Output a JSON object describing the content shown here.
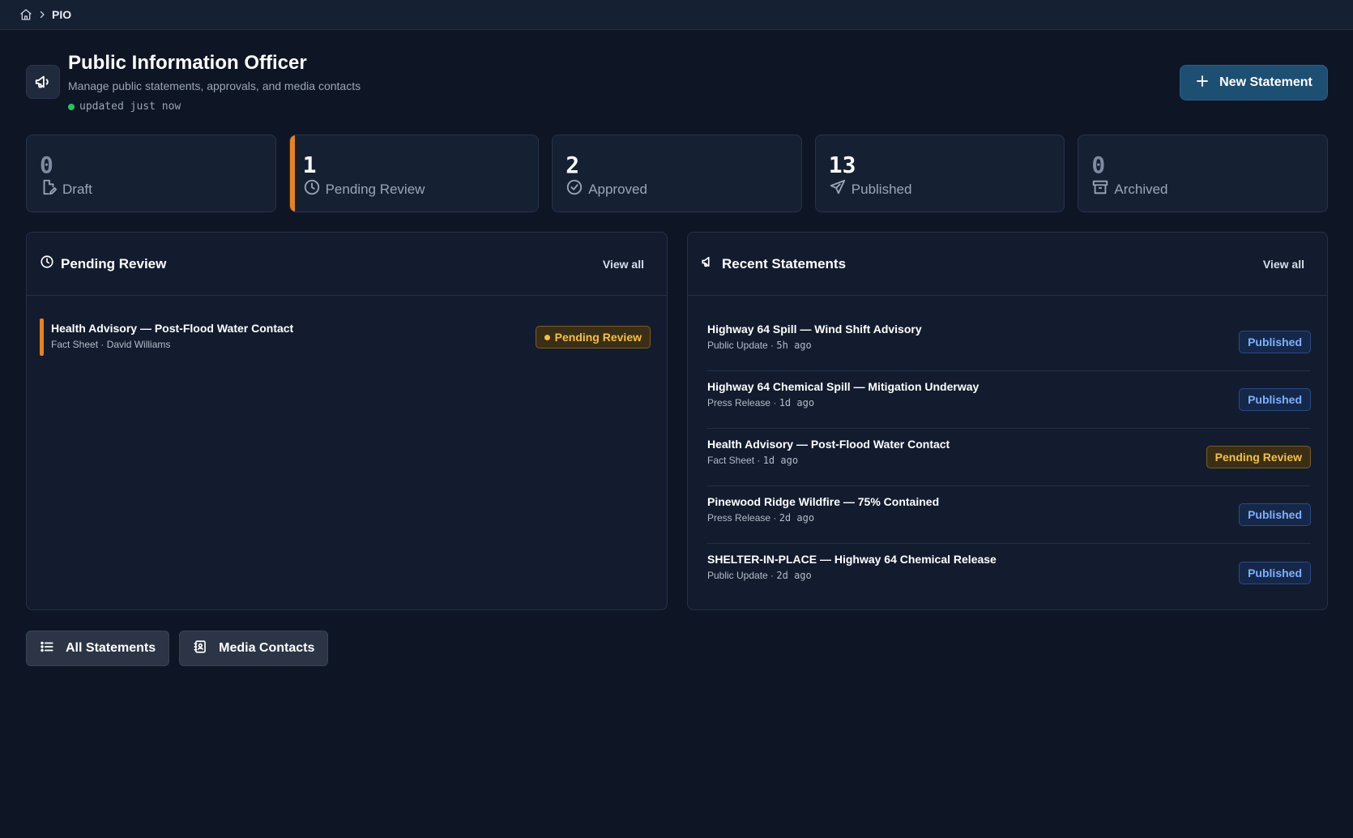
{
  "breadcrumb": {
    "current": "PIO"
  },
  "header": {
    "title": "Public Information Officer",
    "subtitle": "Manage public statements, approvals, and media contacts",
    "updated": "updated just now",
    "new_button": "New Statement"
  },
  "stats": [
    {
      "value": "0",
      "label": "Draft",
      "icon": "file-pen-icon"
    },
    {
      "value": "1",
      "label": "Pending Review",
      "icon": "clock-icon"
    },
    {
      "value": "2",
      "label": "Approved",
      "icon": "check-circle-icon"
    },
    {
      "value": "13",
      "label": "Published",
      "icon": "send-icon"
    },
    {
      "value": "0",
      "label": "Archived",
      "icon": "archive-icon"
    }
  ],
  "pending_panel": {
    "title": "Pending Review",
    "view_all": "View all",
    "items": [
      {
        "title": "Health Advisory — Post-Flood Water Contact",
        "meta": "Fact Sheet · David Williams",
        "status": "Pending Review"
      }
    ]
  },
  "recent_panel": {
    "title": "Recent Statements",
    "view_all": "View all",
    "items": [
      {
        "title": "Highway 64 Spill — Wind Shift Advisory",
        "type": "Public Update · ",
        "time": "5h ago",
        "status": "Published"
      },
      {
        "title": "Highway 64 Chemical Spill — Mitigation Underway",
        "type": "Press Release · ",
        "time": "1d ago",
        "status": "Published"
      },
      {
        "title": "Health Advisory — Post-Flood Water Contact",
        "type": "Fact Sheet · ",
        "time": "1d ago",
        "status": "Pending Review"
      },
      {
        "title": "Pinewood Ridge Wildfire — 75% Contained",
        "type": "Press Release · ",
        "time": "2d ago",
        "status": "Published"
      },
      {
        "title": "SHELTER-IN-PLACE — Highway 64 Chemical Release",
        "type": "Public Update · ",
        "time": "2d ago",
        "status": "Published"
      }
    ]
  },
  "footer": {
    "all_statements": "All Statements",
    "media_contacts": "Media Contacts"
  },
  "colors": {
    "accent_orange": "#e8821c",
    "pending_yellow": "#f5c13a",
    "published_blue": "#7fb0ff",
    "status_green": "#22c55e"
  }
}
